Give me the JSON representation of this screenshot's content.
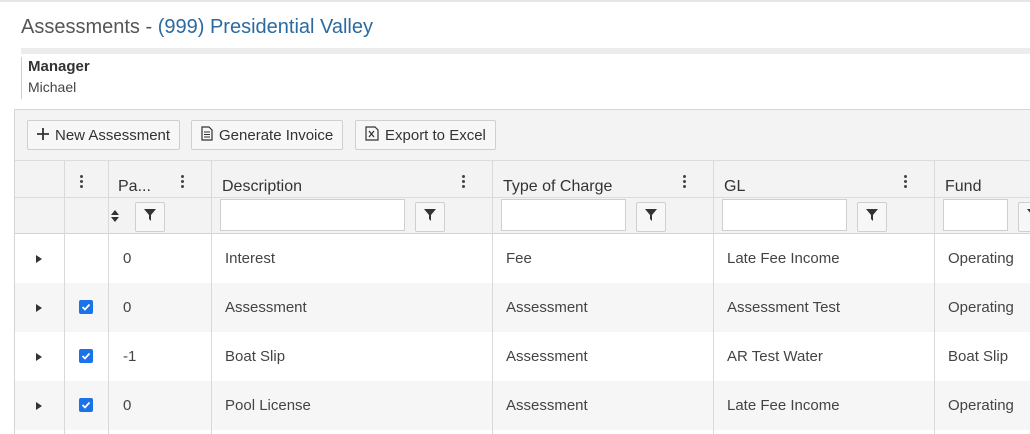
{
  "header": {
    "title_prefix": "Assessments - ",
    "association": "(999) Presidential Valley"
  },
  "manager": {
    "label": "Manager",
    "name": "Michael"
  },
  "toolbar": {
    "new_assessment": "New Assessment",
    "generate_invoice": "Generate Invoice",
    "export_excel": "Export to Excel"
  },
  "columns": {
    "pa": "Pa...",
    "description": "Description",
    "type_of_charge": "Type of Charge",
    "gl": "GL",
    "fund": "Fund"
  },
  "rows": [
    {
      "checked": false,
      "pa": "0",
      "description": "Interest",
      "type": "Fee",
      "gl": "Late Fee Income",
      "fund": "Operating"
    },
    {
      "checked": true,
      "pa": "0",
      "description": "Assessment",
      "type": "Assessment",
      "gl": "Assessment Test",
      "fund": "Operating"
    },
    {
      "checked": true,
      "pa": "-1",
      "description": "Boat Slip",
      "type": "Assessment",
      "gl": "AR Test Water",
      "fund": "Boat Slip"
    },
    {
      "checked": true,
      "pa": "0",
      "description": "Pool License",
      "type": "Assessment",
      "gl": "Late Fee Income",
      "fund": "Operating"
    }
  ],
  "icons": {
    "plus": "plus-icon",
    "document": "document-icon",
    "excel": "excel-icon",
    "filter": "filter-icon",
    "expand": "expand-arrow-icon",
    "checkbox": "checkbox-icon",
    "menu": "column-menu-icon"
  },
  "colors": {
    "link": "#2b6aa0",
    "checkbox": "#1a73e8",
    "header_bg": "#f3f3f3",
    "alt_row": "#f6f6f6"
  }
}
